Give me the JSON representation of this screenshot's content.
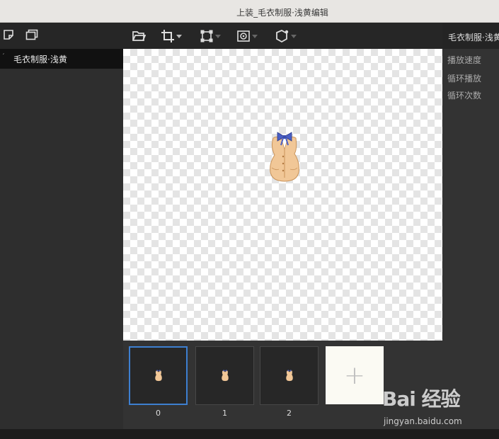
{
  "window": {
    "title": "上装_毛衣制服·浅黄编辑"
  },
  "left_toolbar": {
    "icons": [
      "new-layer-icon",
      "duplicate-layer-icon"
    ]
  },
  "layers": [
    {
      "name": "毛衣制服·浅黄",
      "selected": true
    }
  ],
  "main_toolbar": {
    "tools": [
      "open-folder-icon",
      "crop-icon",
      "transform-icon",
      "anchor-icon",
      "rotate-icon"
    ]
  },
  "canvas": {
    "background": "transparent-checkerboard",
    "sprite": "sweater-uniform-vest-icon"
  },
  "frames": [
    {
      "label": "0",
      "selected": true
    },
    {
      "label": "1",
      "selected": false
    },
    {
      "label": "2",
      "selected": false
    }
  ],
  "add_frame": {
    "label": "+"
  },
  "properties": {
    "header": "毛衣制服·浅黄",
    "items": [
      "播放速度",
      "循环播放",
      "循环次数"
    ]
  },
  "watermark": {
    "brand": "Bai 经验",
    "url": "jingyan.baidu.com"
  },
  "colors": {
    "accent": "#3d7fd0",
    "sprite_body": "#f1c797",
    "bow": "#4a5fc4"
  }
}
